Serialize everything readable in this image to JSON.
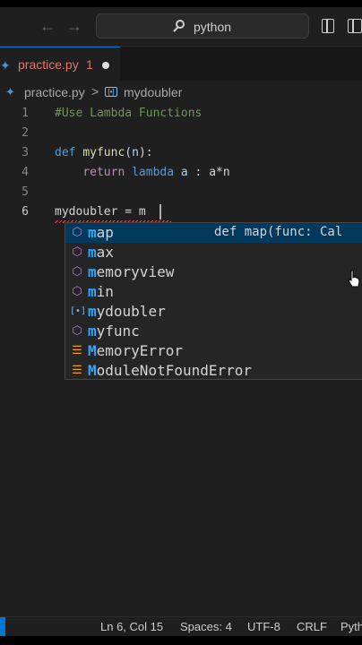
{
  "titlebar": {
    "back_icon": "arrow-left-icon",
    "forward_icon": "arrow-right-icon",
    "search_text": "python",
    "layout_icons": [
      "toggle-sidebar-icon",
      "toggle-panel-icon"
    ]
  },
  "tab": {
    "label": "practice.py",
    "problem_count": "1",
    "modified": true
  },
  "breadcrumb": {
    "file": "practice.py",
    "separator": ">",
    "symbol": "mydoubler"
  },
  "editor": {
    "lines": [
      {
        "number": "1",
        "text": "#Use Lambda Functions"
      },
      {
        "number": "2",
        "text": ""
      },
      {
        "number": "3",
        "text": "def myfunc(n):"
      },
      {
        "number": "4",
        "text": "    return lambda a : a*n"
      },
      {
        "number": "5",
        "text": ""
      },
      {
        "number": "6",
        "text": "mydoubler = m"
      }
    ],
    "active_line": "6"
  },
  "suggestions": {
    "typed_prefix": "m",
    "items": [
      {
        "label": "map",
        "rest": "ap",
        "kind": "method",
        "icon": "method-cube-icon",
        "detail": "def map(func: Cal",
        "selected": true
      },
      {
        "label": "max",
        "rest": "ax",
        "kind": "method",
        "icon": "method-cube-icon"
      },
      {
        "label": "memoryview",
        "rest": "emoryview",
        "kind": "method",
        "icon": "method-cube-icon"
      },
      {
        "label": "min",
        "rest": "in",
        "kind": "method",
        "icon": "method-cube-icon"
      },
      {
        "label": "mydoubler",
        "rest": "ydoubler",
        "kind": "variable",
        "icon": "variable-icon"
      },
      {
        "label": "myfunc",
        "rest": "yfunc",
        "kind": "method",
        "icon": "method-cube-icon"
      },
      {
        "label": "MemoryError",
        "rest": "emoryError",
        "kind": "class",
        "icon": "class-icon"
      },
      {
        "label": "ModuleNotFoundError",
        "rest": "oduleNotFoundError",
        "kind": "class",
        "icon": "class-icon"
      }
    ]
  },
  "statusbar": {
    "position": "Ln 6, Col 15",
    "spaces": "Spaces: 4",
    "encoding": "UTF-8",
    "eol": "CRLF",
    "language": "Pyth"
  },
  "colors": {
    "accent": "#0078d4",
    "tab_error_text": "#e2766c",
    "selected_suggestion": "#04395e",
    "match_highlight": "#2aaaff"
  }
}
